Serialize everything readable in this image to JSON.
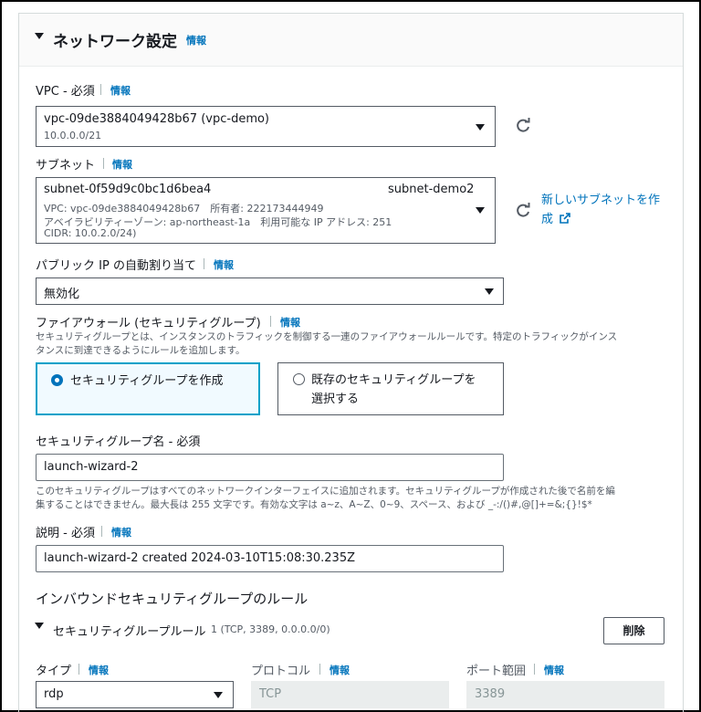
{
  "network": {
    "heading": "ネットワーク設定",
    "info": "情報"
  },
  "vpc": {
    "label": "VPC - 必須",
    "info": "情報",
    "value": "vpc-09de3884049428b67 (vpc-demo)",
    "sub": "10.0.0.0/21"
  },
  "subnet": {
    "label": "サブネット",
    "info": "情報",
    "id": "subnet-0f59d9c0bc1d6bea4",
    "name": "subnet-demo2",
    "line1": "VPC: vpc-09de3884049428b67　所有者: 222173444949",
    "line2": "アベイラビリティーゾーン: ap-northeast-1a　利用可能な IP アドレス: 251",
    "line3": "CIDR: 10.0.2.0/24)",
    "new_link_line1": "新しいサブネットを作",
    "new_link_line2": "成"
  },
  "public_ip": {
    "label": "パブリック IP の自動割り当て",
    "info": "情報",
    "value": "無効化"
  },
  "firewall": {
    "label": "ファイアウォール (セキュリティグループ)",
    "info": "情報",
    "desc_line1": "セキュリティグループとは、インスタンスのトラフィックを制御する一連のファイアウォールルールです。特定のトラフィックがインス",
    "desc_line2": "タンスに到達できるようにルールを追加します。",
    "option_create": "セキュリティグループを作成",
    "option_existing_line1": "既存のセキュリティグループを",
    "option_existing_line2": "選択する"
  },
  "sg_name": {
    "label": "セキュリティグループ名 - 必須",
    "value": "launch-wizard-2",
    "hint_line1": "このセキュリティグループはすべてのネットワークインターフェイスに追加されます。セキュリティグループが作成された後で名前を編",
    "hint_line2": "集することはできません。最大長は 255 文字です。有効な文字は a~z、A~Z、0~9、スペース、および _-:/()#,@[]+=&;{}!$*"
  },
  "description": {
    "label": "説明 - 必須",
    "info": "情報",
    "value": "launch-wizard-2 created 2024-03-10T15:08:30.235Z"
  },
  "inbound": {
    "heading": "インバウンドセキュリティグループのルール",
    "rule_title": "セキュリティグループルール",
    "rule_detail": "1 (TCP, 3389, 0.0.0.0/0)",
    "delete_label": "削除"
  },
  "rule_fields": {
    "type_label": "タイプ",
    "type_info": "情報",
    "type_value": "rdp",
    "protocol_label": "プロトコル",
    "protocol_info": "情報",
    "protocol_value": "TCP",
    "port_label": "ポート範囲",
    "port_info": "情報",
    "port_value": "3389"
  },
  "colors": {
    "link": "#0073bb",
    "selected_border": "#00a1c9",
    "selected_bg": "#f1faff",
    "disabled_bg": "#eaeded"
  }
}
